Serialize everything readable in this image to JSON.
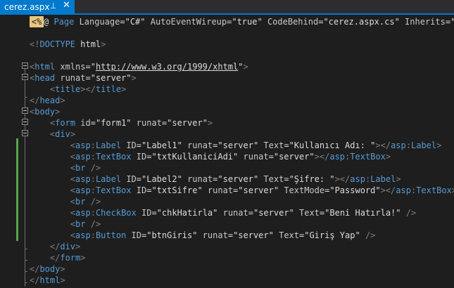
{
  "tab": {
    "title": "cerez.aspx",
    "pin_glyph": "⊥",
    "close_glyph": "✕"
  },
  "lines": [
    [
      {
        "c": "asp-marker",
        "t": "<%"
      },
      {
        "c": "t",
        "t": "@ "
      },
      {
        "c": "e",
        "t": "Page "
      },
      {
        "c": "a",
        "t": "Language"
      },
      {
        "c": "t",
        "t": "="
      },
      {
        "c": "v",
        "t": "\"C#\""
      },
      {
        "c": "t",
        "t": " "
      },
      {
        "c": "a",
        "t": "AutoEventWireup"
      },
      {
        "c": "t",
        "t": "="
      },
      {
        "c": "v",
        "t": "\"true\""
      },
      {
        "c": "t",
        "t": " "
      },
      {
        "c": "a",
        "t": "CodeBehind"
      },
      {
        "c": "t",
        "t": "="
      },
      {
        "c": "v",
        "t": "\"cerez.aspx.cs\""
      },
      {
        "c": "t",
        "t": " "
      },
      {
        "c": "a",
        "t": "Inherits"
      },
      {
        "c": "t",
        "t": "="
      },
      {
        "c": "v",
        "t": "\"coo"
      }
    ],
    [],
    [
      {
        "c": "d",
        "t": "<!"
      },
      {
        "c": "e",
        "t": "DOCTYPE "
      },
      {
        "c": "t",
        "t": "html"
      },
      {
        "c": "d",
        "t": ">"
      }
    ],
    [],
    [
      {
        "c": "d",
        "t": "<"
      },
      {
        "c": "e",
        "t": "html "
      },
      {
        "c": "a",
        "t": "xmlns"
      },
      {
        "c": "t",
        "t": "="
      },
      {
        "c": "v",
        "t": "\""
      },
      {
        "c": "u",
        "t": "http://www.w3.org/1999/xhtml"
      },
      {
        "c": "v",
        "t": "\""
      },
      {
        "c": "d",
        "t": ">"
      }
    ],
    [
      {
        "c": "d",
        "t": "<"
      },
      {
        "c": "e",
        "t": "head "
      },
      {
        "c": "a",
        "t": "runat"
      },
      {
        "c": "t",
        "t": "="
      },
      {
        "c": "v",
        "t": "\"server\""
      },
      {
        "c": "d",
        "t": ">"
      }
    ],
    [
      {
        "c": "sp",
        "t": "    "
      },
      {
        "c": "d",
        "t": "<"
      },
      {
        "c": "e",
        "t": "title"
      },
      {
        "c": "d",
        "t": "></"
      },
      {
        "c": "e",
        "t": "title"
      },
      {
        "c": "d",
        "t": ">"
      }
    ],
    [
      {
        "c": "d",
        "t": "</"
      },
      {
        "c": "e",
        "t": "head"
      },
      {
        "c": "d",
        "t": ">"
      }
    ],
    [
      {
        "c": "d",
        "t": "<"
      },
      {
        "c": "e",
        "t": "body"
      },
      {
        "c": "d",
        "t": ">"
      }
    ],
    [
      {
        "c": "sp",
        "t": "    "
      },
      {
        "c": "d",
        "t": "<"
      },
      {
        "c": "e",
        "t": "form "
      },
      {
        "c": "a",
        "t": "id"
      },
      {
        "c": "t",
        "t": "="
      },
      {
        "c": "v",
        "t": "\"form1\""
      },
      {
        "c": "t",
        "t": " "
      },
      {
        "c": "a",
        "t": "runat"
      },
      {
        "c": "t",
        "t": "="
      },
      {
        "c": "v",
        "t": "\"server\""
      },
      {
        "c": "d",
        "t": ">"
      }
    ],
    [
      {
        "c": "sp",
        "t": "    "
      },
      {
        "c": "d",
        "t": "<"
      },
      {
        "c": "e",
        "t": "div"
      },
      {
        "c": "d",
        "t": ">"
      }
    ],
    [
      {
        "c": "sp",
        "t": "        "
      },
      {
        "c": "d",
        "t": "<"
      },
      {
        "c": "pfx",
        "t": "asp"
      },
      {
        "c": "d",
        "t": ":"
      },
      {
        "c": "e",
        "t": "Label "
      },
      {
        "c": "a",
        "t": "ID"
      },
      {
        "c": "t",
        "t": "="
      },
      {
        "c": "v",
        "t": "\"Label1\""
      },
      {
        "c": "t",
        "t": " "
      },
      {
        "c": "a",
        "t": "runat"
      },
      {
        "c": "t",
        "t": "="
      },
      {
        "c": "v",
        "t": "\"server\""
      },
      {
        "c": "t",
        "t": " "
      },
      {
        "c": "a",
        "t": "Text"
      },
      {
        "c": "t",
        "t": "="
      },
      {
        "c": "v",
        "t": "\"Kullanıcı Adı: \""
      },
      {
        "c": "d",
        "t": "></"
      },
      {
        "c": "pfx",
        "t": "asp"
      },
      {
        "c": "d",
        "t": ":"
      },
      {
        "c": "e",
        "t": "Label"
      },
      {
        "c": "d",
        "t": ">"
      }
    ],
    [
      {
        "c": "sp",
        "t": "        "
      },
      {
        "c": "d",
        "t": "<"
      },
      {
        "c": "pfx",
        "t": "asp"
      },
      {
        "c": "d",
        "t": ":"
      },
      {
        "c": "e",
        "t": "TextBox "
      },
      {
        "c": "a",
        "t": "ID"
      },
      {
        "c": "t",
        "t": "="
      },
      {
        "c": "v",
        "t": "\"txtKullaniciAdi\""
      },
      {
        "c": "t",
        "t": " "
      },
      {
        "c": "a",
        "t": "runat"
      },
      {
        "c": "t",
        "t": "="
      },
      {
        "c": "v",
        "t": "\"server\""
      },
      {
        "c": "d",
        "t": "></"
      },
      {
        "c": "pfx",
        "t": "asp"
      },
      {
        "c": "d",
        "t": ":"
      },
      {
        "c": "e",
        "t": "TextBox"
      },
      {
        "c": "d",
        "t": ">"
      }
    ],
    [
      {
        "c": "sp",
        "t": "        "
      },
      {
        "c": "d",
        "t": "<"
      },
      {
        "c": "e",
        "t": "br "
      },
      {
        "c": "d",
        "t": "/>"
      }
    ],
    [
      {
        "c": "sp",
        "t": "        "
      },
      {
        "c": "d",
        "t": "<"
      },
      {
        "c": "pfx",
        "t": "asp"
      },
      {
        "c": "d",
        "t": ":"
      },
      {
        "c": "e",
        "t": "Label "
      },
      {
        "c": "a",
        "t": "ID"
      },
      {
        "c": "t",
        "t": "="
      },
      {
        "c": "v",
        "t": "\"Label2\""
      },
      {
        "c": "t",
        "t": " "
      },
      {
        "c": "a",
        "t": "runat"
      },
      {
        "c": "t",
        "t": "="
      },
      {
        "c": "v",
        "t": "\"server\""
      },
      {
        "c": "t",
        "t": " "
      },
      {
        "c": "a",
        "t": "Text"
      },
      {
        "c": "t",
        "t": "="
      },
      {
        "c": "v",
        "t": "\"Şifre: \""
      },
      {
        "c": "d",
        "t": "></"
      },
      {
        "c": "pfx",
        "t": "asp"
      },
      {
        "c": "d",
        "t": ":"
      },
      {
        "c": "e",
        "t": "Label"
      },
      {
        "c": "d",
        "t": ">"
      }
    ],
    [
      {
        "c": "sp",
        "t": "        "
      },
      {
        "c": "d",
        "t": "<"
      },
      {
        "c": "pfx",
        "t": "asp"
      },
      {
        "c": "d",
        "t": ":"
      },
      {
        "c": "e",
        "t": "TextBox "
      },
      {
        "c": "a",
        "t": "ID"
      },
      {
        "c": "t",
        "t": "="
      },
      {
        "c": "v",
        "t": "\"txtSifre\""
      },
      {
        "c": "t",
        "t": " "
      },
      {
        "c": "a",
        "t": "runat"
      },
      {
        "c": "t",
        "t": "="
      },
      {
        "c": "v",
        "t": "\"server\""
      },
      {
        "c": "t",
        "t": " "
      },
      {
        "c": "a",
        "t": "TextMode"
      },
      {
        "c": "t",
        "t": "="
      },
      {
        "c": "v",
        "t": "\"Password\""
      },
      {
        "c": "d",
        "t": "></"
      },
      {
        "c": "pfx",
        "t": "asp"
      },
      {
        "c": "d",
        "t": ":"
      },
      {
        "c": "e",
        "t": "TextBox"
      },
      {
        "c": "d",
        "t": ">"
      }
    ],
    [
      {
        "c": "sp",
        "t": "        "
      },
      {
        "c": "d",
        "t": "<"
      },
      {
        "c": "e",
        "t": "br "
      },
      {
        "c": "d",
        "t": "/>"
      }
    ],
    [
      {
        "c": "sp",
        "t": "        "
      },
      {
        "c": "d",
        "t": "<"
      },
      {
        "c": "pfx",
        "t": "asp"
      },
      {
        "c": "d",
        "t": ":"
      },
      {
        "c": "e",
        "t": "CheckBox "
      },
      {
        "c": "a",
        "t": "ID"
      },
      {
        "c": "t",
        "t": "="
      },
      {
        "c": "v",
        "t": "\"chkHatirla\""
      },
      {
        "c": "t",
        "t": " "
      },
      {
        "c": "a",
        "t": "runat"
      },
      {
        "c": "t",
        "t": "="
      },
      {
        "c": "v",
        "t": "\"server\""
      },
      {
        "c": "t",
        "t": " "
      },
      {
        "c": "a",
        "t": "Text"
      },
      {
        "c": "t",
        "t": "="
      },
      {
        "c": "v",
        "t": "\"Beni Hatırla!\""
      },
      {
        "c": "t",
        "t": " "
      },
      {
        "c": "d",
        "t": "/>"
      }
    ],
    [
      {
        "c": "sp",
        "t": "        "
      },
      {
        "c": "d",
        "t": "<"
      },
      {
        "c": "e",
        "t": "br "
      },
      {
        "c": "d",
        "t": "/>"
      }
    ],
    [
      {
        "c": "sp",
        "t": "        "
      },
      {
        "c": "d",
        "t": "<"
      },
      {
        "c": "pfx",
        "t": "asp"
      },
      {
        "c": "d",
        "t": ":"
      },
      {
        "c": "e",
        "t": "Button "
      },
      {
        "c": "a",
        "t": "ID"
      },
      {
        "c": "t",
        "t": "="
      },
      {
        "c": "v",
        "t": "\"btnGiris\""
      },
      {
        "c": "t",
        "t": " "
      },
      {
        "c": "a",
        "t": "runat"
      },
      {
        "c": "t",
        "t": "="
      },
      {
        "c": "v",
        "t": "\"server\""
      },
      {
        "c": "t",
        "t": " "
      },
      {
        "c": "a",
        "t": "Text"
      },
      {
        "c": "t",
        "t": "="
      },
      {
        "c": "v",
        "t": "\"Giriş Yap\""
      },
      {
        "c": "t",
        "t": " "
      },
      {
        "c": "d",
        "t": "/>"
      }
    ],
    [
      {
        "c": "sp",
        "t": "    "
      },
      {
        "c": "d",
        "t": "</"
      },
      {
        "c": "e",
        "t": "div"
      },
      {
        "c": "d",
        "t": ">"
      }
    ],
    [
      {
        "c": "sp",
        "t": "    "
      },
      {
        "c": "d",
        "t": "</"
      },
      {
        "c": "e",
        "t": "form"
      },
      {
        "c": "d",
        "t": ">"
      }
    ],
    [
      {
        "c": "d",
        "t": "</"
      },
      {
        "c": "e",
        "t": "body"
      },
      {
        "c": "d",
        "t": ">"
      }
    ],
    [
      {
        "c": "d",
        "t": "</"
      },
      {
        "c": "e",
        "t": "html"
      },
      {
        "c": "d",
        "t": ">"
      }
    ]
  ]
}
